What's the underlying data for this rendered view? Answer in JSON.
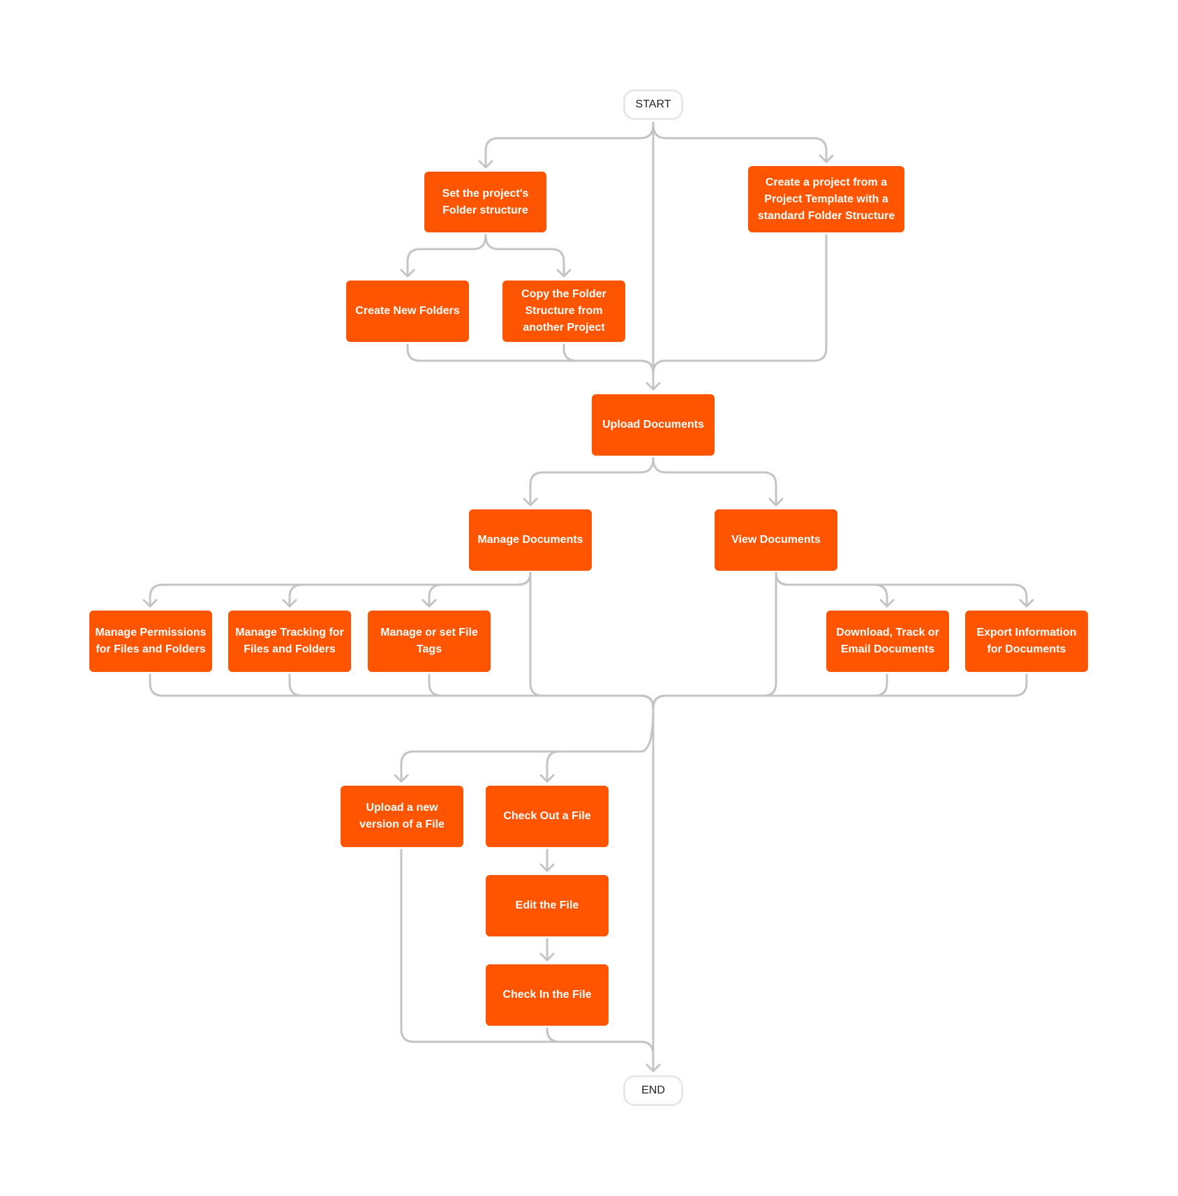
{
  "diagram": {
    "type": "flowchart",
    "colors": {
      "node_fill": "#ff5500",
      "node_text": "#ffffff",
      "connector": "#c4c4c4",
      "terminal_border": "#e8e8e8"
    },
    "start": "START",
    "end": "END",
    "nodes": {
      "set_folder_structure": "Set the project's\nFolder structure",
      "create_from_template": "Create a project from a\nProject Template with a\nstandard Folder Structure",
      "create_new_folders": "Create New Folders",
      "copy_folder_structure": "Copy the Folder\nStructure from\nanother Project",
      "upload_documents": "Upload Documents",
      "manage_documents": "Manage Documents",
      "view_documents": "View Documents",
      "manage_permissions": "Manage Permissions\nfor Files and Folders",
      "manage_tracking": "Manage Tracking for\nFiles and Folders",
      "manage_tags": "Manage or set File\nTags",
      "download_track_email": "Download, Track or\nEmail Documents",
      "export_information": "Export Information\nfor Documents",
      "upload_new_version": "Upload a new\nversion of a File",
      "check_out": "Check Out a File",
      "edit_file": "Edit the File",
      "check_in": "Check In the File"
    },
    "edges": [
      [
        "START",
        "set_folder_structure"
      ],
      [
        "START",
        "create_from_template"
      ],
      [
        "START",
        "upload_documents"
      ],
      [
        "set_folder_structure",
        "create_new_folders"
      ],
      [
        "set_folder_structure",
        "copy_folder_structure"
      ],
      [
        "create_new_folders",
        "upload_documents"
      ],
      [
        "copy_folder_structure",
        "upload_documents"
      ],
      [
        "create_from_template",
        "upload_documents"
      ],
      [
        "upload_documents",
        "manage_documents"
      ],
      [
        "upload_documents",
        "view_documents"
      ],
      [
        "manage_documents",
        "manage_permissions"
      ],
      [
        "manage_documents",
        "manage_tracking"
      ],
      [
        "manage_documents",
        "manage_tags"
      ],
      [
        "view_documents",
        "download_track_email"
      ],
      [
        "view_documents",
        "export_information"
      ],
      [
        "merge",
        "upload_new_version"
      ],
      [
        "merge",
        "check_out"
      ],
      [
        "merge",
        "END"
      ],
      [
        "check_out",
        "edit_file"
      ],
      [
        "edit_file",
        "check_in"
      ],
      [
        "upload_new_version",
        "END"
      ],
      [
        "check_in",
        "END"
      ]
    ]
  }
}
